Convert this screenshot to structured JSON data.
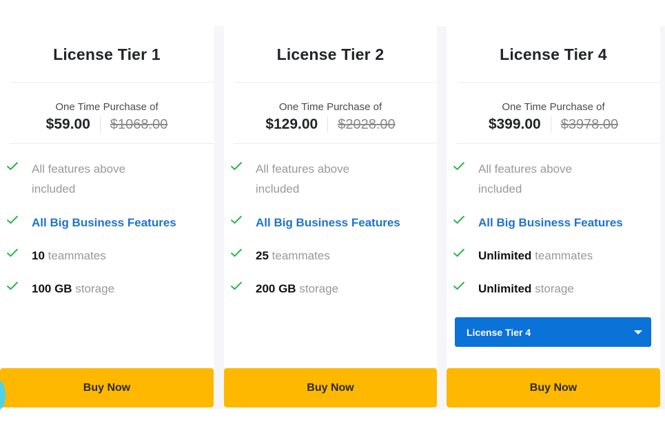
{
  "cards": [
    {
      "title": "License Tier 1",
      "price_label": "One Time Purchase of",
      "price": "$59.00",
      "original_price": "$1068.00",
      "features": {
        "f0": {
          "text": "All features above included"
        },
        "f1": {
          "text": "All Big Business Features"
        },
        "f2": {
          "strong": "10",
          "text": "teammates"
        },
        "f3": {
          "strong": "100 GB",
          "text": "storage"
        }
      },
      "buy_label": "Buy Now"
    },
    {
      "title": "License Tier 2",
      "price_label": "One Time Purchase of",
      "price": "$129.00",
      "original_price": "$2028.00",
      "features": {
        "f0": {
          "text": "All features above included"
        },
        "f1": {
          "text": "All Big Business Features"
        },
        "f2": {
          "strong": "25",
          "text": "teammates"
        },
        "f3": {
          "strong": "200 GB",
          "text": "storage"
        }
      },
      "buy_label": "Buy Now"
    },
    {
      "title": "License Tier 4",
      "price_label": "One Time Purchase of",
      "price": "$399.00",
      "original_price": "$3978.00",
      "features": {
        "f0": {
          "text": "All features above included"
        },
        "f1": {
          "text": "All Big Business Features"
        },
        "f2": {
          "strong": "Unlimited",
          "text": "teammates"
        },
        "f3": {
          "strong": "Unlimited",
          "text": "storage"
        }
      },
      "tier_select": {
        "selected": "License Tier 4",
        "icon": "caret-down-icon"
      },
      "buy_label": "Buy Now"
    }
  ],
  "icons": {
    "feature_check": "check-icon",
    "chat": "chat-bubble-icon"
  },
  "colors": {
    "accent_blue": "#1e73cf",
    "select_blue": "#0b72d8",
    "buy_yellow": "#ffb800",
    "check_green": "#2fb34a"
  }
}
